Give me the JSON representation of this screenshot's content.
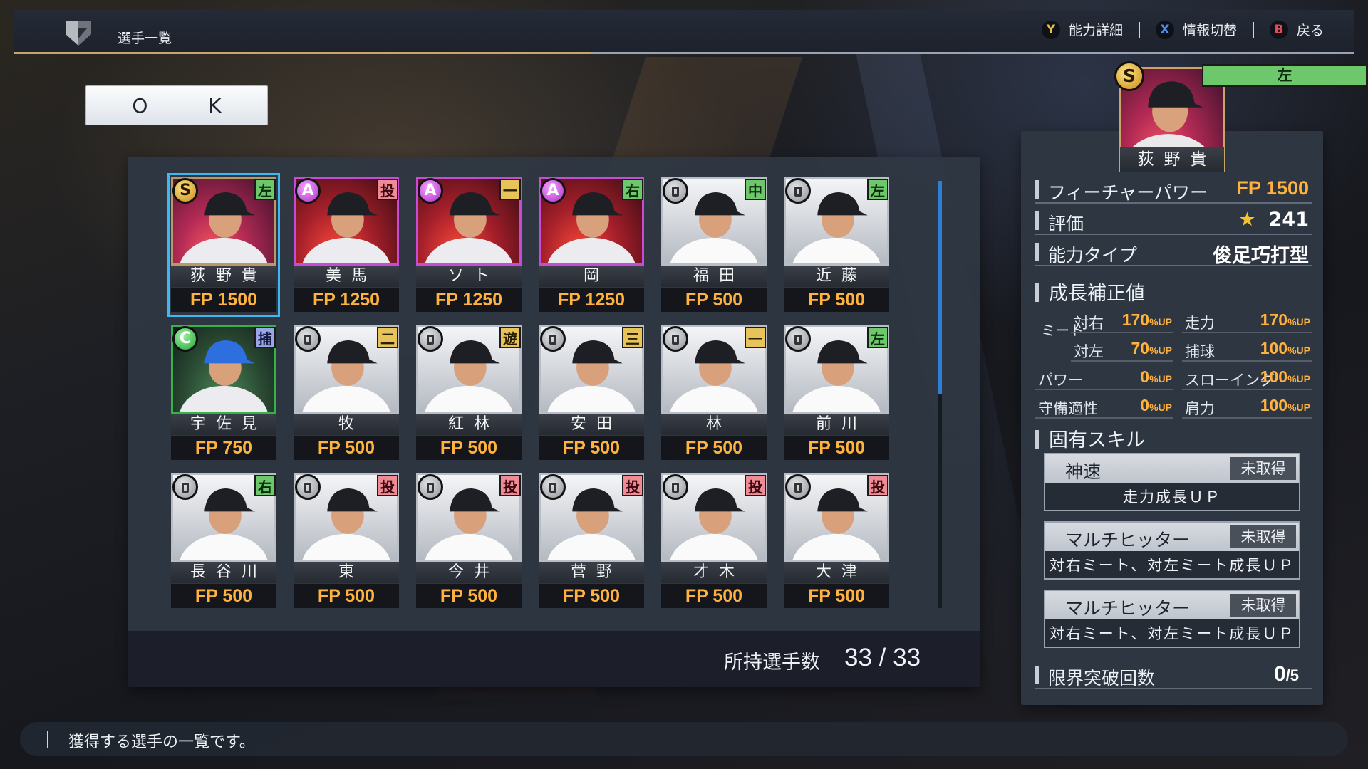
{
  "header": {
    "title": "選手一覧",
    "hints": [
      {
        "button": "Y",
        "label": "能力詳細"
      },
      {
        "button": "X",
        "label": "情報切替"
      },
      {
        "button": "B",
        "label": "戻る"
      }
    ]
  },
  "ok_button": {
    "label": "O K"
  },
  "roster": {
    "players": [
      {
        "rank": "S",
        "pos": "左",
        "pos_color": "green",
        "name": "荻野貴",
        "fp": "FP 1500",
        "selected": true
      },
      {
        "rank": "A",
        "pos": "投",
        "pos_color": "red",
        "name": "美馬",
        "fp": "FP 1250"
      },
      {
        "rank": "A",
        "pos": "一",
        "pos_color": "yellow",
        "name": "ソト",
        "fp": "FP 1250"
      },
      {
        "rank": "A",
        "pos": "右",
        "pos_color": "green",
        "name": "岡",
        "fp": "FP 1250"
      },
      {
        "rank": "D",
        "pos": "中",
        "pos_color": "green",
        "name": "福田",
        "fp": "FP 500"
      },
      {
        "rank": "D",
        "pos": "左",
        "pos_color": "green",
        "name": "近藤",
        "fp": "FP 500"
      },
      {
        "rank": "C",
        "pos": "捕",
        "pos_color": "purple",
        "name": "宇佐見",
        "fp": "FP 750"
      },
      {
        "rank": "D",
        "pos": "二",
        "pos_color": "yellow",
        "name": "牧",
        "fp": "FP 500"
      },
      {
        "rank": "D",
        "pos": "遊",
        "pos_color": "yellow",
        "name": "紅林",
        "fp": "FP 500"
      },
      {
        "rank": "D",
        "pos": "三",
        "pos_color": "yellow",
        "name": "安田",
        "fp": "FP 500"
      },
      {
        "rank": "D",
        "pos": "一",
        "pos_color": "yellow",
        "name": "林",
        "fp": "FP 500"
      },
      {
        "rank": "D",
        "pos": "左",
        "pos_color": "green",
        "name": "前川",
        "fp": "FP 500"
      },
      {
        "rank": "D",
        "pos": "右",
        "pos_color": "green",
        "name": "長谷川",
        "fp": "FP 500"
      },
      {
        "rank": "D",
        "pos": "投",
        "pos_color": "red",
        "name": "東",
        "fp": "FP 500"
      },
      {
        "rank": "D",
        "pos": "投",
        "pos_color": "red",
        "name": "今井",
        "fp": "FP 500"
      },
      {
        "rank": "D",
        "pos": "投",
        "pos_color": "red",
        "name": "菅野",
        "fp": "FP 500"
      },
      {
        "rank": "D",
        "pos": "投",
        "pos_color": "red",
        "name": "才木",
        "fp": "FP 500"
      },
      {
        "rank": "D",
        "pos": "投",
        "pos_color": "red",
        "name": "大津",
        "fp": "FP 500"
      }
    ],
    "owned_label": "所持選手数",
    "owned_value": "33 / 33",
    "scroll_fraction": 0.5
  },
  "detail": {
    "rank": "S",
    "pos": "左",
    "name": "荻野貴",
    "feature_power_label": "フィーチャーパワー",
    "feature_power_value": "FP 1500",
    "rating_label": "評価",
    "rating_value": "241",
    "ability_type_label": "能力タイプ",
    "ability_type_value": "俊足巧打型",
    "growth_heading": "成長補正値",
    "meet_label": "ミート",
    "growth": [
      {
        "label": "対右",
        "value": "170",
        "unit": "%UP"
      },
      {
        "label": "走力",
        "value": "170",
        "unit": "%UP"
      },
      {
        "label": "対左",
        "value": "70",
        "unit": "%UP"
      },
      {
        "label": "捕球",
        "value": "100",
        "unit": "%UP"
      },
      {
        "label": "パワー",
        "value": "0",
        "unit": "%UP"
      },
      {
        "label": "スローイング",
        "value": "100",
        "unit": "%UP"
      },
      {
        "label": "守備適性",
        "value": "0",
        "unit": "%UP"
      },
      {
        "label": "肩力",
        "value": "100",
        "unit": "%UP"
      }
    ],
    "skills_heading": "固有スキル",
    "skills": [
      {
        "name": "神速",
        "status": "未取得",
        "desc": "走力成長ＵＰ"
      },
      {
        "name": "マルチヒッター",
        "status": "未取得",
        "desc": "対右ミート、対左ミート成長ＵＰ"
      },
      {
        "name": "マルチヒッター",
        "status": "未取得",
        "desc": "対右ミート、対左ミート成長ＵＰ"
      }
    ],
    "limit_label": "限界突破回数",
    "limit_value": "0",
    "limit_max": "/5"
  },
  "help": {
    "text": "獲得する選手の一覧です。"
  },
  "colors": {
    "accent": "#c9a56a",
    "fp": "#ffb23e",
    "selection": "#3fb8f2"
  }
}
